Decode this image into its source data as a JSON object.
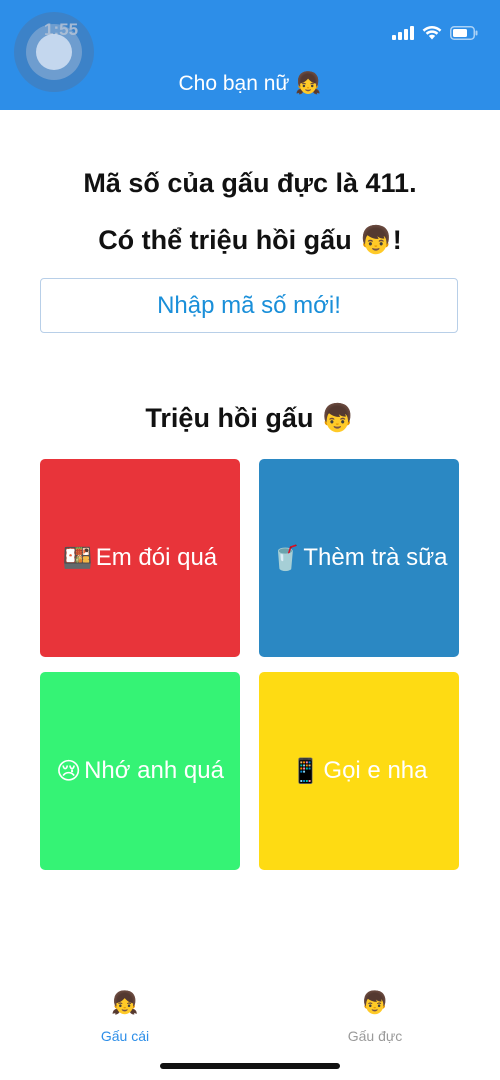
{
  "status_bar": {
    "time": "1:55"
  },
  "header": {
    "title": "Cho bạn nữ 👧"
  },
  "code_info": {
    "line1": "Mã số của gấu đực là 411.",
    "line2": "Có thể triệu hồi gấu 👦!"
  },
  "new_code_button": {
    "label": "Nhập mã số mới!"
  },
  "summon_section": {
    "title": "Triệu hồi gấu 👦",
    "tiles": [
      {
        "emoji": "🍱",
        "label": "Em đói quá",
        "color": "#e8343a"
      },
      {
        "emoji": "🥤",
        "label": "Thèm trà sữa",
        "color": "#2b88c3"
      },
      {
        "emoji": "😢",
        "label": "Nhớ anh quá",
        "color": "#35f375"
      },
      {
        "emoji": "📱",
        "label": "Gọi e nha",
        "color": "#fedb13"
      }
    ]
  },
  "tab_bar": {
    "tabs": [
      {
        "icon": "👧",
        "label": "Gấu cái",
        "active": true
      },
      {
        "icon": "👦",
        "label": "Gấu đực",
        "active": false
      }
    ]
  },
  "colors": {
    "header": "#2d8ee8",
    "accent": "#1a8fd9",
    "inactive_tab": "#9a9a9a"
  }
}
